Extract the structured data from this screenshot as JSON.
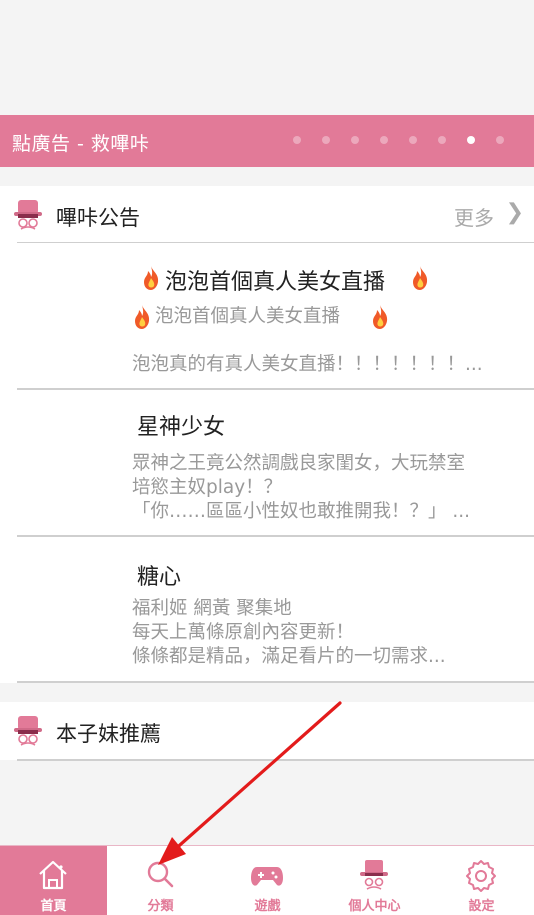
{
  "ad_banner": {
    "title": "點廣告 - 救嗶咔",
    "dot_count": 8,
    "active_dot": 6
  },
  "announcements": {
    "title": "嗶咔公告",
    "more_label": "更多",
    "items": [
      {
        "title": "泡泡首個真人美女直播",
        "subtitle": "泡泡首個真人美女直播",
        "desc": "泡泡真的有真人美女直播！！！！！！！..."
      },
      {
        "title": "星神少女",
        "desc_lines": [
          "眾神之王竟公然調戲良家閨女，大玩禁室",
          "培慾主奴play！？",
          "「你……區區小性奴也敢推開我！？」 ..."
        ]
      },
      {
        "title": "糖心",
        "desc_lines": [
          "福利姬 網黃 聚集地",
          "每天上萬條原創內容更新！",
          "條條都是精品，滿足看片的一切需求..."
        ]
      }
    ]
  },
  "recommend": {
    "title": "本子妹推薦"
  },
  "tabbar": {
    "items": [
      {
        "label": "首頁",
        "icon": "home-icon",
        "active": true
      },
      {
        "label": "分類",
        "icon": "search-icon"
      },
      {
        "label": "遊戲",
        "icon": "gamepad-icon"
      },
      {
        "label": "個人中心",
        "icon": "hat-icon"
      },
      {
        "label": "設定",
        "icon": "gear-icon"
      }
    ]
  },
  "colors": {
    "accent": "#e27a98",
    "fire": "#f05a28"
  }
}
